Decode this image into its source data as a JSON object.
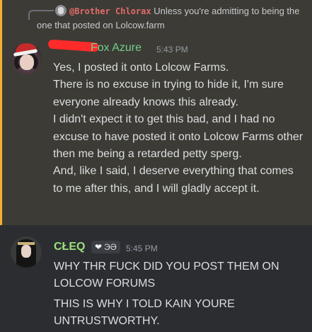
{
  "reply": {
    "mention": "@Brother Chlorax",
    "text": "Unless you're admitting to being the one that posted on Lolcow.farm"
  },
  "message1": {
    "username": "Fox Azure",
    "timestamp": "5:43 PM",
    "lines": [
      "Yes, I posted it onto Lolcow Farms.",
      "There is no excuse in trying to hide it, I'm sure everyone already knows this already.",
      "I didn't expect it to get this bad, and I had no excuse to have posted it onto Lolcow Farms other then me being a retarded petty sperg.",
      "And, like I said, I deserve everything that comes to me after this, and I will gladly accept it."
    ]
  },
  "message2": {
    "username": "CŁEQ",
    "tag_heart": "❤",
    "tag_text": "ЭƏ",
    "timestamp": "5:45 PM",
    "lines": [
      "WHY THR FUCK DID YOU POST THEM ON LOLCOW FORUMS",
      "THIS IS WHY I TOLD KAIN YOURE UNTRUSTWORTHY."
    ]
  },
  "colors": {
    "highlight_bg": "#3d3b35",
    "mention_accent": "#f0b232",
    "username1": "#6fd08c",
    "username2": "#9be07c"
  }
}
